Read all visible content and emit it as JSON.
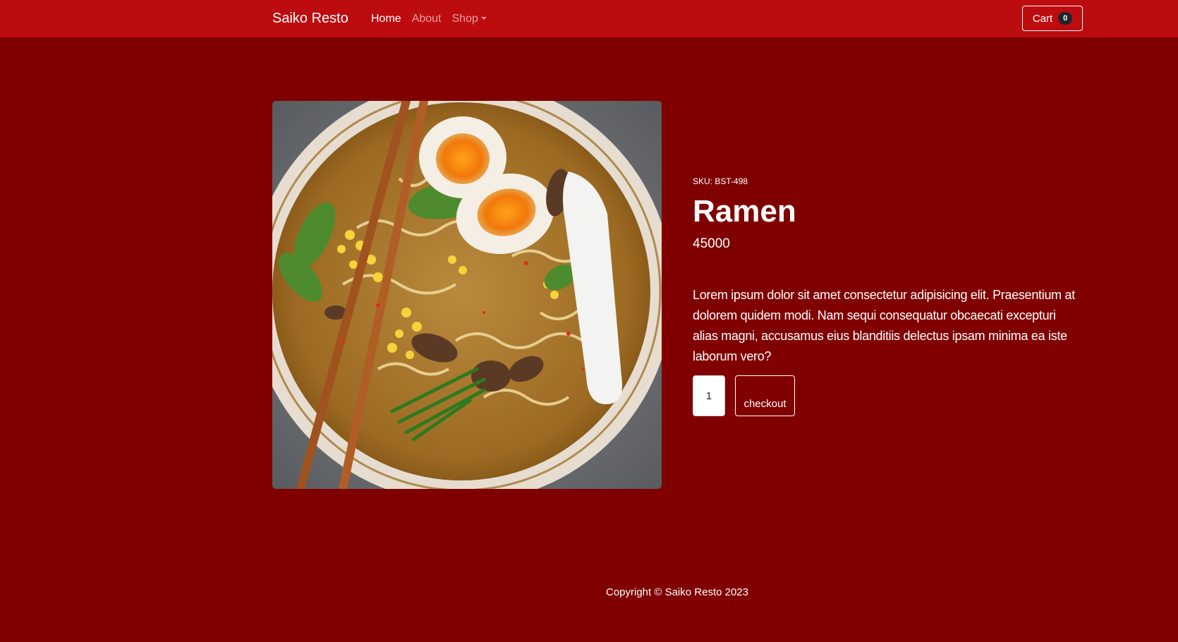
{
  "navbar": {
    "brand": "Saiko Resto",
    "links": [
      "Home",
      "About",
      "Shop"
    ],
    "cart_label": "Cart",
    "cart_count": "0"
  },
  "product": {
    "sku": "SKU: BST-498",
    "name": "Ramen",
    "price": "45000",
    "description": "Lorem ipsum dolor sit amet consectetur adipisicing elit. Praesentium at dolorem quidem modi. Nam sequi consequatur obcaecati excepturi alias magni, accusamus eius blanditiis delectus ipsam minima ea iste laborum vero?",
    "quantity": "1",
    "checkout_label": "checkout"
  },
  "footer": {
    "copyright": "Copyright © Saiko Resto 2023"
  },
  "colors": {
    "background": "#800000",
    "navbar": "#bd0c10",
    "badge": "#212529"
  }
}
